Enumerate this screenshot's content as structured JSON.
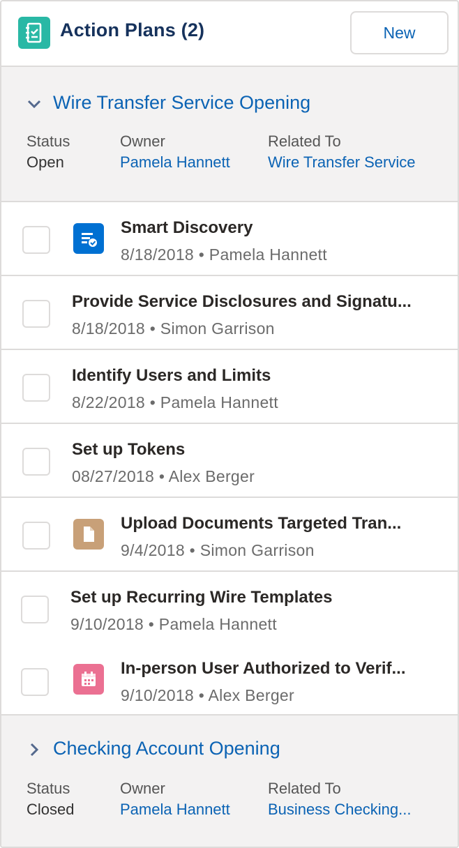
{
  "header": {
    "title": "Action Plans (2)",
    "new_label": "New",
    "icon": "action-plan-icon",
    "icon_color": "#29b8a5"
  },
  "plans": [
    {
      "title": "Wire Transfer Service Opening",
      "expanded": true,
      "status_label": "Status",
      "status": "Open",
      "owner_label": "Owner",
      "owner": "Pamela Hannett",
      "related_label": "Related To",
      "related": "Wire Transfer Service"
    },
    {
      "title": "Checking Account Opening",
      "expanded": false,
      "status_label": "Status",
      "status": "Closed",
      "owner_label": "Owner",
      "owner": "Pamela Hannett",
      "related_label": "Related To",
      "related": "Business Checking..."
    }
  ],
  "tasks": [
    {
      "title": "Smart Discovery",
      "date": "8/18/2018",
      "owner": "Pamela Hannett",
      "icon": "discovery-icon",
      "icon_color": "#0070d2"
    },
    {
      "title": "Provide Service Disclosures and Signatu...",
      "date": "8/18/2018",
      "owner": "Simon Garrison"
    },
    {
      "title": "Identify Users and Limits",
      "date": "8/22/2018",
      "owner": "Pamela Hannett"
    },
    {
      "title": "Set up Tokens",
      "date": "08/27/2018",
      "owner": "Alex Berger"
    },
    {
      "title": "Upload Documents Targeted Tran...",
      "date": "9/4/2018",
      "owner": "Simon Garrison",
      "icon": "document-icon",
      "icon_color": "#c8a078"
    },
    {
      "title": "Set up Recurring Wire Templates",
      "date": "9/10/2018",
      "owner": "Pamela Hannett"
    },
    {
      "title": "In-person User Authorized to Verif...",
      "date": "9/10/2018",
      "owner": "Alex Berger",
      "icon": "event-calendar-icon",
      "icon_color": "#eb7092"
    }
  ],
  "separator": "•"
}
